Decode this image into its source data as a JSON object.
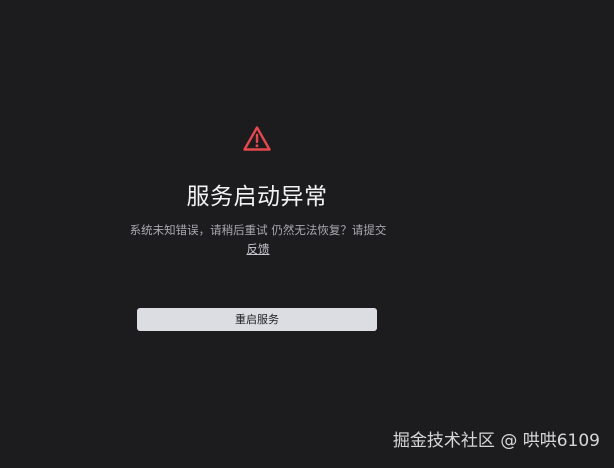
{
  "error": {
    "icon": "warning-triangle-icon",
    "icon_color": "#e5484d",
    "title": "服务启动异常",
    "message_line1": "系统未知错误，请稍后重试 仍然无法恢复？请提交",
    "feedback_link": "反馈",
    "restart_button": "重启服务"
  },
  "watermark": "掘金技术社区 @ 哄哄6109",
  "colors": {
    "background": "#1c1c1e",
    "button_background": "#dcdde2"
  }
}
